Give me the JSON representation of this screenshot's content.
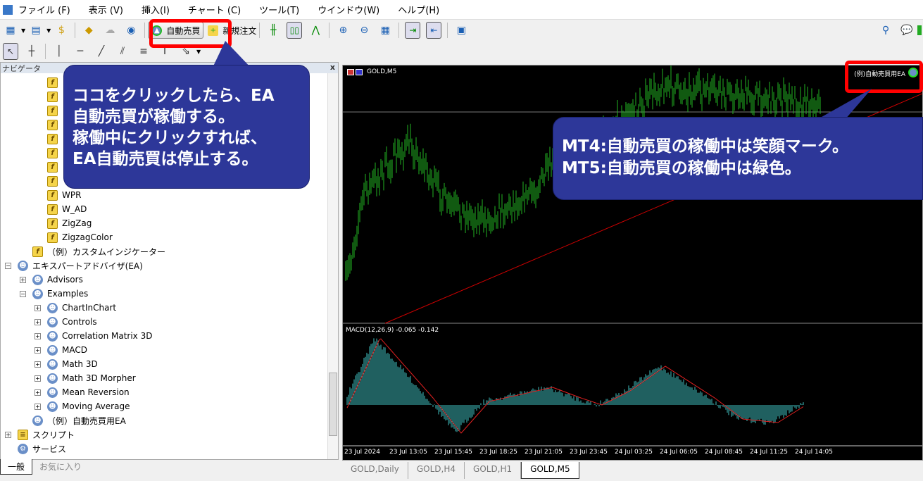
{
  "menu": [
    "ファイル (F)",
    "表示 (V)",
    "挿入(I)",
    "チャート (C)",
    "ツール(T)",
    "ウインドウ(W)",
    "ヘルプ(H)"
  ],
  "toolbar": {
    "autotrade": "自動売買",
    "neworder": "新規注文"
  },
  "navigator": {
    "title": "ナビゲータ",
    "close": "x",
    "items": [
      {
        "label": "WPR",
        "type": "indicator"
      },
      {
        "label": "W_AD",
        "type": "indicator"
      },
      {
        "label": "ZigZag",
        "type": "indicator"
      },
      {
        "label": "ZigzagColor",
        "type": "indicator"
      },
      {
        "label": "（例）カスタムインジケーター",
        "type": "indicator"
      },
      {
        "label": "エキスパートアドバイザ(EA)",
        "type": "ea-folder"
      },
      {
        "label": "Advisors",
        "type": "ea"
      },
      {
        "label": "Examples",
        "type": "ea"
      },
      {
        "label": "ChartInChart",
        "type": "ea"
      },
      {
        "label": "Controls",
        "type": "ea"
      },
      {
        "label": "Correlation Matrix 3D",
        "type": "ea"
      },
      {
        "label": "MACD",
        "type": "ea"
      },
      {
        "label": "Math 3D",
        "type": "ea"
      },
      {
        "label": "Math 3D Morpher",
        "type": "ea"
      },
      {
        "label": "Mean Reversion",
        "type": "ea"
      },
      {
        "label": "Moving Average",
        "type": "ea"
      },
      {
        "label": "（例）自動売買用EA",
        "type": "ea"
      },
      {
        "label": "スクリプト",
        "type": "script"
      },
      {
        "label": "サービス",
        "type": "service"
      }
    ],
    "tabs": [
      "一般",
      "お気に入り"
    ]
  },
  "chart": {
    "symbol": "GOLD,M5",
    "ea_name": "(例)自動売買用EA",
    "macd_label": "MACD(12,26,9) -0.065 -0.142",
    "time_labels": [
      "23 Jul 2024",
      "23 Jul 13:05",
      "23 Jul 15:45",
      "23 Jul 18:25",
      "23 Jul 21:05",
      "23 Jul 23:45",
      "24 Jul 03:25",
      "24 Jul 06:05",
      "24 Jul 08:45",
      "24 Jul 11:25",
      "24 Jul 14:05"
    ],
    "tabs": [
      "GOLD,Daily",
      "GOLD,H4",
      "GOLD,H1",
      "GOLD,M5"
    ],
    "active_tab": "GOLD,M5",
    "colors": {
      "candle": "#22b322",
      "macd": "#40c0c0",
      "signal": "#e02020"
    }
  },
  "callouts": {
    "left": [
      "ココをクリックしたら、EA",
      "自動売買が稼働する。",
      "稼働中にクリックすれば、",
      "EA自動売買は停止する。"
    ],
    "right": [
      "MT4:自動売買の稼働中は笑顔マーク。",
      "MT5:自動売買の稼働中は緑色。"
    ]
  }
}
